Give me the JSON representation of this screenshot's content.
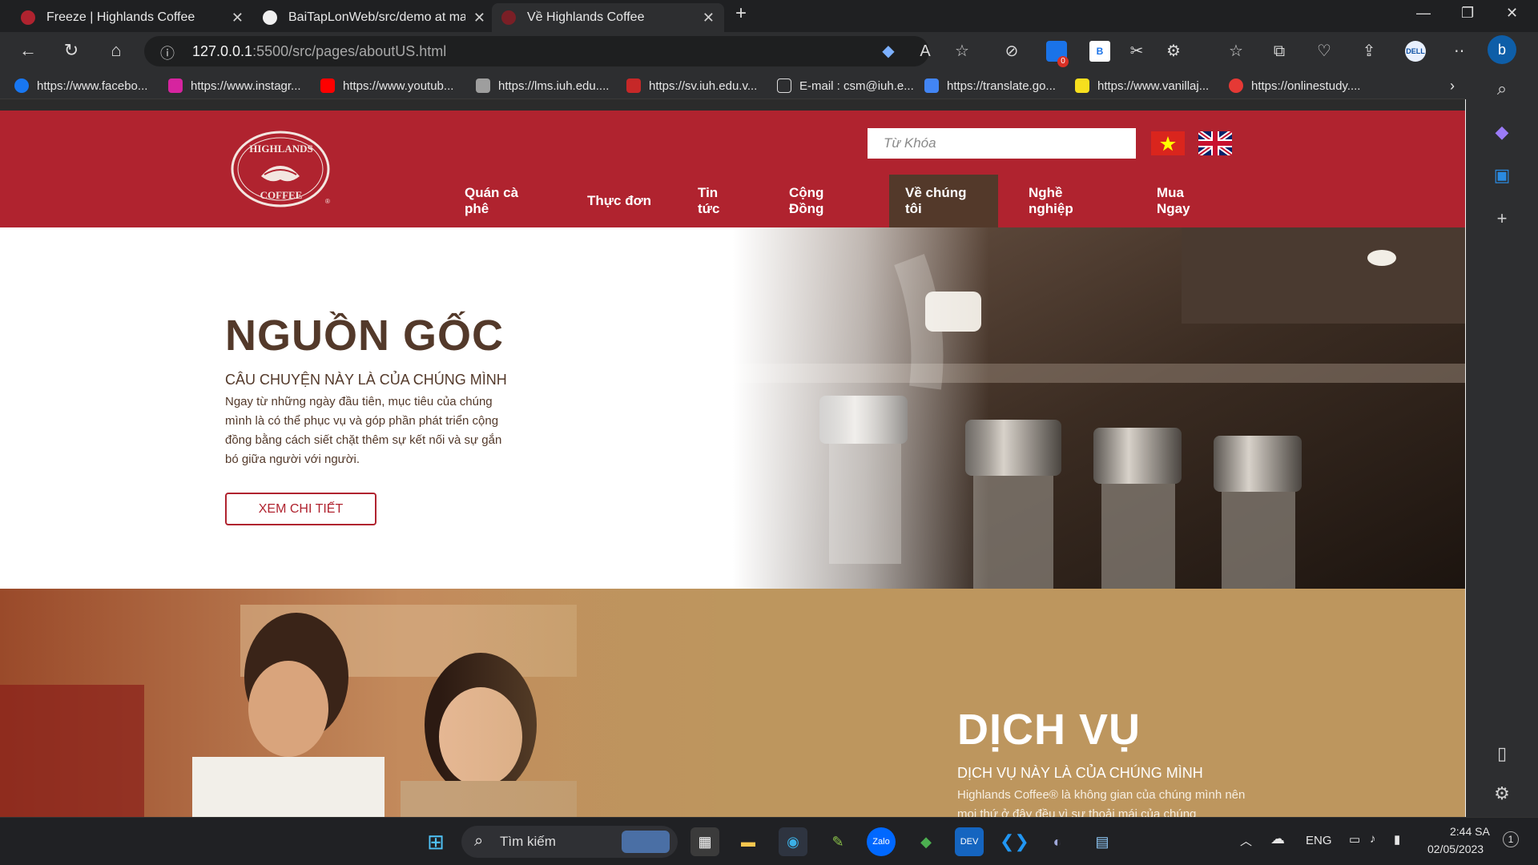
{
  "browser": {
    "tabs": [
      {
        "title": "Freeze | Highlands Coffee",
        "active": false
      },
      {
        "title": "BaiTapLonWeb/src/demo at main",
        "active": false
      },
      {
        "title": "Về Highlands Coffee",
        "active": true
      }
    ],
    "url_host": "127.0.0.1",
    "url_path": ":5500/src/pages/aboutUS.html",
    "bookmarks": [
      "https://www.facebo...",
      "https://www.instagr...",
      "https://www.youtub...",
      "https://lms.iuh.edu....",
      "https://sv.iuh.edu.v...",
      "E-mail : csm@iuh.e...",
      "https://translate.go...",
      "https://www.vanillaj...",
      "https://onlinestudy...."
    ],
    "ext_badge": "0"
  },
  "site": {
    "search_placeholder": "Từ Khóa",
    "nav": [
      {
        "label": "Quán cà phê"
      },
      {
        "label": "Thực đơn"
      },
      {
        "label": "Tin tức"
      },
      {
        "label": "Cộng Đồng"
      },
      {
        "label": "Về chúng tôi",
        "active": true
      },
      {
        "label": "Nghề nghiệp"
      },
      {
        "label": "Mua Ngay"
      }
    ],
    "logo_text_top": "HIGHLANDS",
    "logo_text_bottom": "COFFEE",
    "logo_mark": "®",
    "section1": {
      "title": "NGUỒN GỐC",
      "subtitle": "CÂU CHUYỆN NÀY LÀ CỦA CHÚNG MÌNH",
      "body": "Ngay từ những ngày đầu tiên, mục tiêu của chúng mình là có thể phục vụ và góp phần phát triển cộng đồng bằng cách siết chặt thêm sự kết nối và sự gắn bó giữa người với người.",
      "button": "XEM CHI TIẾT"
    },
    "section2": {
      "title": "DỊCH VỤ",
      "subtitle": "DỊCH VỤ NÀY LÀ CỦA CHÚNG MÌNH",
      "body": "Highlands Coffee® là không gian của chúng mình nên mọi thứ ở đây đều vì sự thoải mái của chúng"
    }
  },
  "taskbar": {
    "search_label": "Tìm kiếm",
    "lang": "ENG",
    "time": "2:44 SA",
    "date": "02/05/2023"
  },
  "colors": {
    "brand_red": "#b0232f",
    "brand_brown": "#53392a",
    "section2_bg": "#bd965e"
  }
}
